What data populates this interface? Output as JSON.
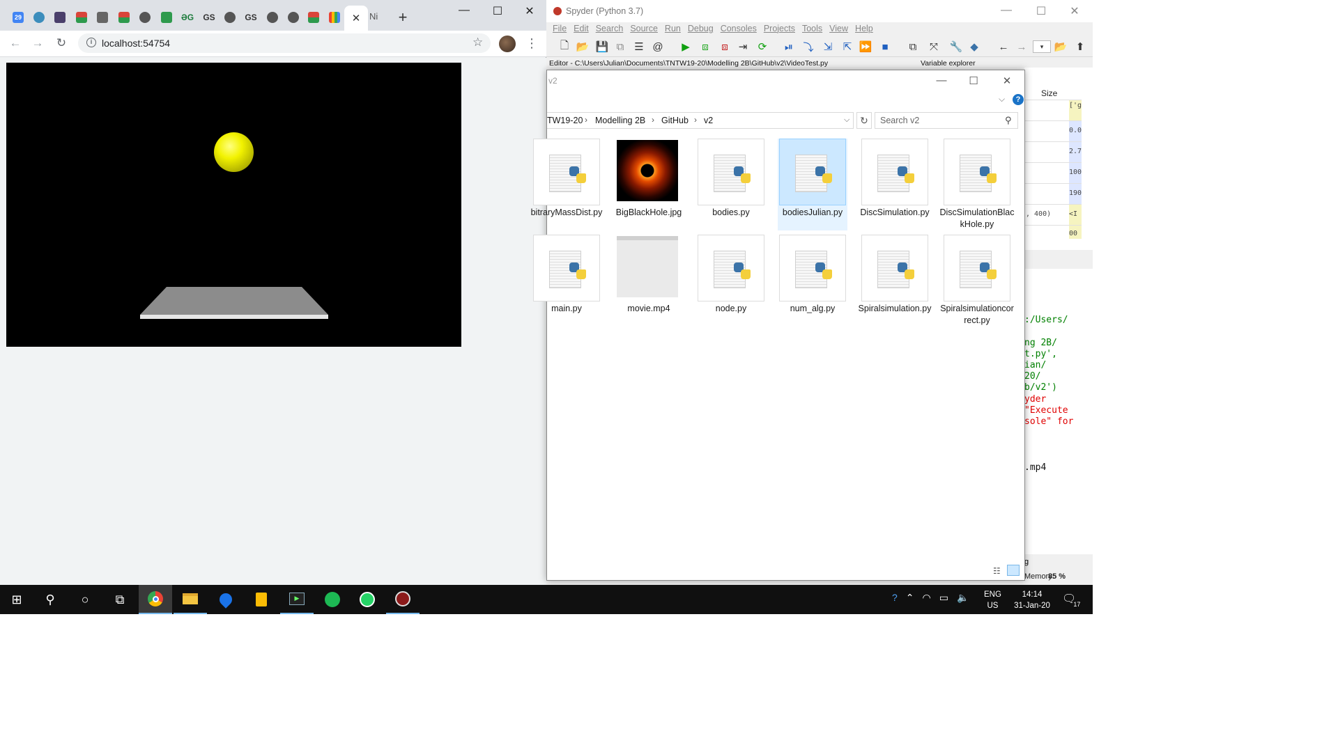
{
  "chrome": {
    "active_tab_close": "✕",
    "next_tab_label": "Ni",
    "new_tab": "+",
    "url": "localhost:54754",
    "tab_favicons": [
      "calendar-icon",
      "globe-icon",
      "image-icon",
      "wolfram-icon",
      "cube-icon",
      "wolfram-icon",
      "chrome-icon",
      "sheet-icon",
      "dictionary-icon",
      "scholar-icon",
      "chrome-icon",
      "scholar-icon",
      "chrome-icon",
      "chrome-icon",
      "wolfram-icon",
      "apps-icon"
    ],
    "calendar_day": "29"
  },
  "spyder": {
    "title": "Spyder (Python 3.7)",
    "menu": [
      "File",
      "Edit",
      "Search",
      "Source",
      "Run",
      "Debug",
      "Consoles",
      "Projects",
      "Tools",
      "View",
      "Help"
    ],
    "editor_label": "Editor - C:\\Users\\Julian\\Documents\\TNTW19-20\\Modelling 2B\\GitHub\\v2\\VideoTest.py",
    "variable_explorer_label": "Variable explorer",
    "varexp_size_header": "Size",
    "varexp_rows": [
      "['g",
      "0.0",
      "2.7",
      "100",
      "190",
      ", 400)",
      "<I",
      "00"
    ],
    "console_lines": [
      {
        "text": ":/Users/",
        "color": "#008000"
      },
      {
        "text": "",
        "color": "#000"
      },
      {
        "text": "ng 2B/",
        "color": "#008000"
      },
      {
        "text": "t.py',",
        "color": "#008000"
      },
      {
        "text": "ian/",
        "color": "#008000"
      },
      {
        "text": "20/",
        "color": "#008000"
      },
      {
        "text": "b/v2')",
        "color": "#008000"
      },
      {
        "text": "yder",
        "color": "#e00000"
      },
      {
        "text": "\"Execute",
        "color": "#e00000"
      },
      {
        "text": "sole\" for",
        "color": "#e00000"
      },
      {
        "text": "",
        "color": "#000"
      },
      {
        "text": "",
        "color": "#000"
      },
      {
        "text": ".mp4",
        "color": "#111"
      }
    ],
    "status_memory_label": "Memory:",
    "status_memory_value": "85 %",
    "status_snippet": "g"
  },
  "explorer": {
    "title": "v2",
    "breadcrumb": [
      "TW19-20",
      "Modelling 2B",
      "GitHub",
      "v2"
    ],
    "search_placeholder": "Search v2",
    "files": [
      {
        "name": "bitraryMassDist.py",
        "type": "py"
      },
      {
        "name": "BigBlackHole.jpg",
        "type": "jpg"
      },
      {
        "name": "bodies.py",
        "type": "py"
      },
      {
        "name": "bodiesJulian.py",
        "type": "py",
        "selected": true
      },
      {
        "name": "DiscSimulation.py",
        "type": "py"
      },
      {
        "name": "DiscSimulationBlackHole.py",
        "type": "py"
      },
      {
        "name": "main.py",
        "type": "py"
      },
      {
        "name": "movie.mp4",
        "type": "mp4"
      },
      {
        "name": "node.py",
        "type": "py"
      },
      {
        "name": "num_alg.py",
        "type": "py"
      },
      {
        "name": "Spiralsimulation.py",
        "type": "py"
      },
      {
        "name": "Spiralsimulationcorrect.py",
        "type": "py"
      }
    ]
  },
  "taskbar": {
    "apps": [
      "start-icon",
      "search-icon",
      "cortana-icon",
      "task-view-icon",
      "chrome-icon",
      "file-explorer-icon",
      "maps-icon",
      "keep-icon",
      "terminal-icon",
      "spotify-icon",
      "whatsapp-icon",
      "spyder-icon"
    ],
    "lang_top": "ENG",
    "lang_bottom": "US",
    "time": "14:14",
    "date": "31-Jan-20",
    "notification_count": "17"
  },
  "colors": {
    "ball": "#f2f200",
    "plate": "#8c8c8c",
    "selection": "#cce8ff",
    "taskbar": "#101010"
  }
}
